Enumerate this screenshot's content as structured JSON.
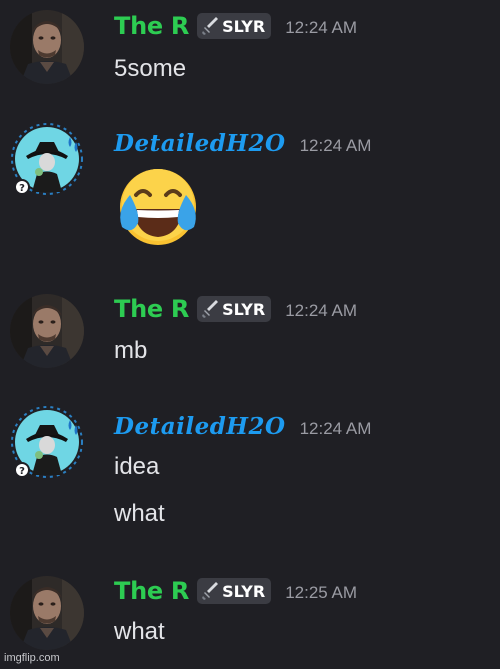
{
  "users": {
    "the_r": {
      "name": "The R",
      "tag": "SLYR",
      "tag_icon": "sword-icon",
      "name_color": "#2dcc52"
    },
    "detailed": {
      "name": "DetailedH2O",
      "name_color": "#1d9bf0"
    }
  },
  "messages": [
    {
      "author": "The R",
      "time": "12:24 AM",
      "lines": [
        "5some"
      ]
    },
    {
      "author": "DetailedH2O",
      "time": "12:24 AM",
      "emoji": "joy-emoji"
    },
    {
      "author": "The R",
      "time": "12:24 AM",
      "lines": [
        "mb"
      ]
    },
    {
      "author": "DetailedH2O",
      "time": "12:24 AM",
      "lines": [
        "idea",
        "what"
      ]
    },
    {
      "author": "The R",
      "time": "12:25 AM",
      "lines": [
        "what"
      ]
    }
  ],
  "watermark": "imgflip.com"
}
